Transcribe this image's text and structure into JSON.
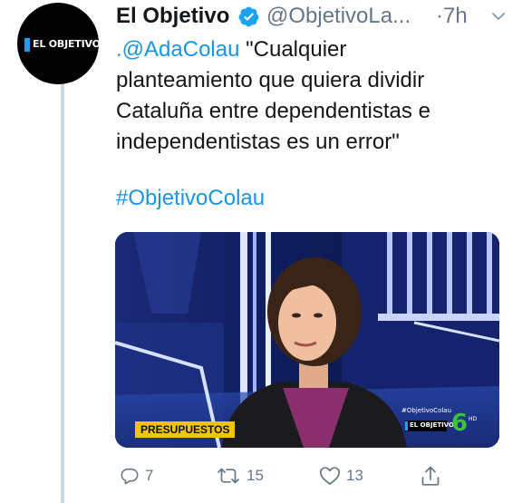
{
  "author": {
    "name": "El Objetivo",
    "handle": "@ObjetivoLa...",
    "verified": true,
    "avatar_logo_text": "EL OBJETIVO"
  },
  "tweet": {
    "time": "·7h",
    "mention": ".@AdaColau",
    "text_lines": [
      " \"Cualquier",
      "planteamiento que quiera dividir",
      "Cataluña entre dependentistas e",
      "independentistas es un error\""
    ],
    "hashtag": "#ObjetivoColau"
  },
  "media": {
    "caption": "PRESUPUESTOS",
    "watermark": "#ObjetivoColau",
    "logo_text": "EL OBJETIVO",
    "channel": "6",
    "channel_tag": "HD"
  },
  "actions": {
    "reply_count": "7",
    "retweet_count": "15",
    "like_count": "13"
  },
  "colors": {
    "link": "#1b95e0",
    "secondary_text": "#657786",
    "verified": "#1da1f2",
    "thread_line": "#ccd6dd"
  }
}
